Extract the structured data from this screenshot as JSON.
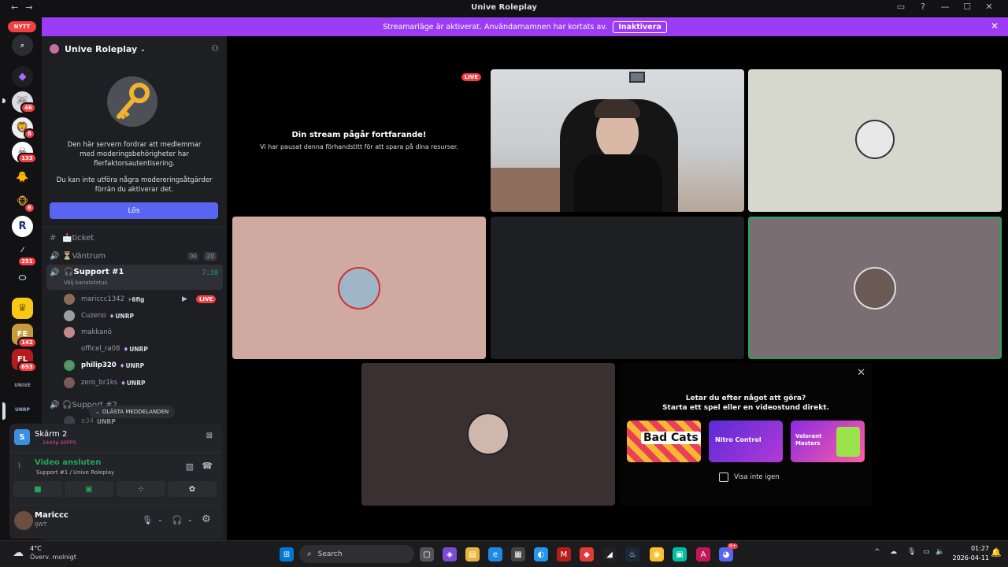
{
  "window": {
    "title": "Unive Roleplay",
    "back": "←",
    "forward": "→",
    "help": "?",
    "minimize": "—",
    "maximize": "☐",
    "close": "✕"
  },
  "banner": {
    "text": "Streamarläge är aktiverat. Användarnamnen har kortats av.",
    "button": "Inaktivera",
    "close": "✕"
  },
  "servers": {
    "new_label": "NYTT",
    "badges": [
      "46",
      "8",
      "133",
      "6",
      "251",
      "142",
      "693"
    ]
  },
  "sidebar": {
    "server_name": "Unive Roleplay",
    "notice_text_1": "Den här servern fordrar att medlemmar med moderingsbehörigheter har flerfaktorsautentisering.",
    "notice_text_2": "Du kan inte utföra några modereringsåtgärder förrän du aktiverar det.",
    "fix_button": "Lös",
    "channels": {
      "ticket": "📩ticket",
      "wait_room": "⏳Väntrum",
      "wait_count_a": "00",
      "wait_count_b": "20",
      "support1": "🎧Support #1",
      "support1_time": "7:30",
      "support1_status": "Välj kanalstatus",
      "support2": "🎧Support #2"
    },
    "users": [
      {
        "name": "mariccc1342",
        "tag": "⚡6fig",
        "live": "LIVE"
      },
      {
        "name": "Cuzeno",
        "tag": "UNRP"
      },
      {
        "name": "makkanö",
        "tag": ""
      },
      {
        "name": "officel_ra08",
        "tag": "UNRP"
      },
      {
        "name": "philip320",
        "tag": "UNRP"
      },
      {
        "name": "zero_br1ks",
        "tag": "UNRP"
      },
      {
        "name": "e34",
        "tag": "UNRP"
      }
    ],
    "unread_pill": "OLÄSTA MEDDELANDEN"
  },
  "voice_panel": {
    "screen_name": "Skärm 2",
    "screen_quality": "1440p 60FPS",
    "status": "Video ansluten",
    "location": "Support #1 / Unive Roleplay",
    "user_name": "Mariccc",
    "user_status": "IJWT"
  },
  "stage": {
    "live_badge": "LIVE",
    "paused_title": "Din stream pågår fortfarande!",
    "paused_text": "Vi har pausat denna förhandstitt för att spara på dina resurser.",
    "activity_title": "Letar du efter något att göra?",
    "activity_subtitle": "Starta ett spel eller en videostund direkt.",
    "activity_games": [
      "Bad Cats",
      "Nitro Control",
      "Valorant Masters"
    ],
    "dont_show": "Visa inte igen",
    "close": "✕"
  },
  "taskbar": {
    "temp": "4°C",
    "weather": "Överv. molnigt",
    "search": "Search",
    "time": "01:27",
    "date": "2026-04-11",
    "discord_badge": "9+"
  }
}
